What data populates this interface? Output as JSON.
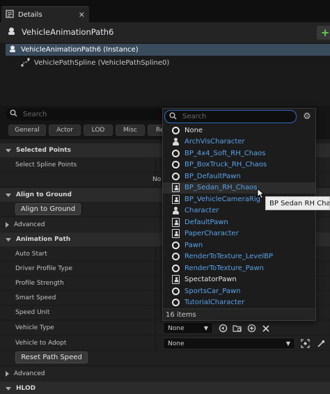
{
  "tab": {
    "title": "Details",
    "close": "✕"
  },
  "header": {
    "actor_name": "VehicleAnimationPath6",
    "add_label": "+"
  },
  "tree": {
    "instance_label": "VehicleAnimationPath6 (Instance)",
    "child_label": "VehiclePathSpline (VehiclePathSpline0)"
  },
  "search": {
    "placeholder": "Search"
  },
  "filters": [
    "General",
    "Actor",
    "LOD",
    "Misc",
    "Re"
  ],
  "sections": {
    "selected_points": "Selected Points",
    "align_to_ground": "Align to Ground",
    "advanced_1": "Advanced",
    "animation_path": "Animation Path",
    "advanced_2": "Advanced",
    "hlod": "HLOD"
  },
  "properties": {
    "select_spline_points": "Select Spline Points",
    "no_text": "No",
    "align_button": "Align to Ground",
    "auto_start": "Auto Start",
    "driver_profile_type": "Driver Profile Type",
    "profile_strength": "Profile Strength",
    "smart_speed": "Smart Speed",
    "speed_unit": "Speed Unit",
    "vehicle_type": "Vehicle Type",
    "vehicle_type_value": "None",
    "vehicle_to_adopt": "Vehicle to Adopt",
    "vehicle_to_adopt_value": "None",
    "reset_button": "Reset Path Speed"
  },
  "popup": {
    "search_placeholder": "Search",
    "items": [
      {
        "label": "None",
        "icon": "ring",
        "color": "white"
      },
      {
        "label": "ArchVisCharacter",
        "icon": "pawn",
        "color": "blue"
      },
      {
        "label": "BP_4x4_Soft_RH_Chaos",
        "icon": "ring",
        "color": "blue"
      },
      {
        "label": "BP_BoxTruck_RH_Chaos",
        "icon": "ring",
        "color": "blue"
      },
      {
        "label": "BP_DefaultPawn",
        "icon": "ring",
        "color": "blue"
      },
      {
        "label": "BP_Sedan_RH_Chaos",
        "icon": "pawn-box",
        "color": "blue"
      },
      {
        "label": "BP_VehicleCameraRig",
        "icon": "pawn-box",
        "color": "blue"
      },
      {
        "label": "Character",
        "icon": "pawn",
        "color": "blue"
      },
      {
        "label": "DefaultPawn",
        "icon": "pawn-box",
        "color": "blue"
      },
      {
        "label": "PaperCharacter",
        "icon": "pawn-box",
        "color": "blue"
      },
      {
        "label": "Pawn",
        "icon": "ring",
        "color": "blue"
      },
      {
        "label": "RenderToTexture_LevelBP",
        "icon": "ring",
        "color": "blue"
      },
      {
        "label": "RenderToTexture_Pawn",
        "icon": "ring",
        "color": "blue"
      },
      {
        "label": "SpectatorPawn",
        "icon": "pawn-box",
        "color": "white"
      },
      {
        "label": "SportsCar_Pawn",
        "icon": "ring",
        "color": "blue"
      },
      {
        "label": "TutorialCharacter",
        "icon": "ring",
        "color": "blue"
      }
    ],
    "footer": "16 items",
    "tooltip": "BP Sedan RH Chaos"
  },
  "colors": {
    "accent": "#2e6bc0",
    "link_blue": "#5aa2e8",
    "add_green": "#5fd44d"
  }
}
